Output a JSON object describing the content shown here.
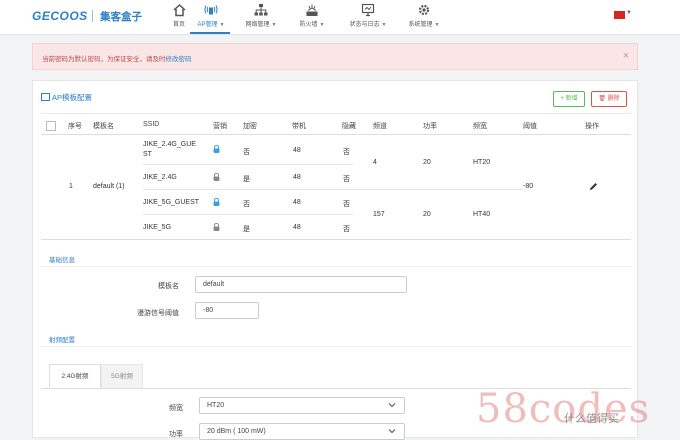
{
  "header": {
    "logo": "GECOOS",
    "logo_cn": "集客盒子",
    "nav": [
      {
        "label": "首页",
        "icon": "home-icon",
        "dropdown": false
      },
      {
        "label": "AP管理",
        "icon": "wifi-icon",
        "dropdown": true,
        "active": true
      },
      {
        "label": "网络管理",
        "icon": "network-icon",
        "dropdown": true
      },
      {
        "label": "防火墙",
        "icon": "firewall-icon",
        "dropdown": true
      },
      {
        "label": "状态与日志",
        "icon": "monitor-icon",
        "dropdown": true
      },
      {
        "label": "系统管理",
        "icon": "gear-icon",
        "dropdown": true
      }
    ],
    "language_flag": "china-flag-icon"
  },
  "alert": {
    "text": "当前密码为默认密码，为保证安全，请及时",
    "link": "修改密码",
    "close": "×"
  },
  "panel": {
    "title": "AP模板配置",
    "new_button": "+ 新增",
    "delete_button": "🗑 删除"
  },
  "table": {
    "headers": {
      "index": "序号",
      "name": "模板名",
      "ssid": "SSID",
      "marketing": "营销",
      "encrypt": "加密",
      "bandwidth": "带机",
      "hidden": "隐藏",
      "channel": "频道",
      "power": "功率",
      "freq_width": "频宽",
      "threshold": "阈值",
      "action": "操作"
    },
    "row": {
      "index": "1",
      "name": "default (1)",
      "threshold": "-80",
      "ssids": [
        {
          "ssid_line1": "JIKE_2.4G_GUE",
          "ssid_line2": "ST",
          "marketing": "enabled",
          "encrypt": "否",
          "bandwidth": "48",
          "hidden": "否"
        },
        {
          "ssid_line1": "JIKE_2.4G",
          "ssid_line2": "",
          "marketing": "disabled",
          "encrypt": "是",
          "bandwidth": "48",
          "hidden": "否"
        },
        {
          "ssid_line1": "JIKE_5G_GUEST",
          "ssid_line2": "",
          "marketing": "enabled",
          "encrypt": "否",
          "bandwidth": "48",
          "hidden": "否"
        },
        {
          "ssid_line1": "JIKE_5G",
          "ssid_line2": "",
          "marketing": "disabled",
          "encrypt": "是",
          "bandwidth": "48",
          "hidden": "否"
        }
      ],
      "band_24": {
        "channel": "4",
        "power": "20",
        "freq_width": "HT20"
      },
      "band_5": {
        "channel": "157",
        "power": "20",
        "freq_width": "HT40"
      }
    }
  },
  "basic": {
    "title": "基础信息",
    "name_label": "模板名",
    "name_value": "default",
    "roam_label": "漫游信号阈值",
    "roam_value": "-80"
  },
  "radio": {
    "title": "射频配置",
    "tabs": [
      "2.4G射频",
      "5G射频"
    ],
    "width_label": "频宽",
    "width_value": "HT20",
    "power_label": "功率",
    "power_value": "20 dBm ( 100 mW)"
  },
  "watermark": {
    "text": "58codes",
    "cn": "什么值得买"
  },
  "colors": {
    "accent": "#2e7fc7",
    "alert_bg": "#fae6e7",
    "success": "#5cb85c",
    "danger": "#d9534f"
  }
}
